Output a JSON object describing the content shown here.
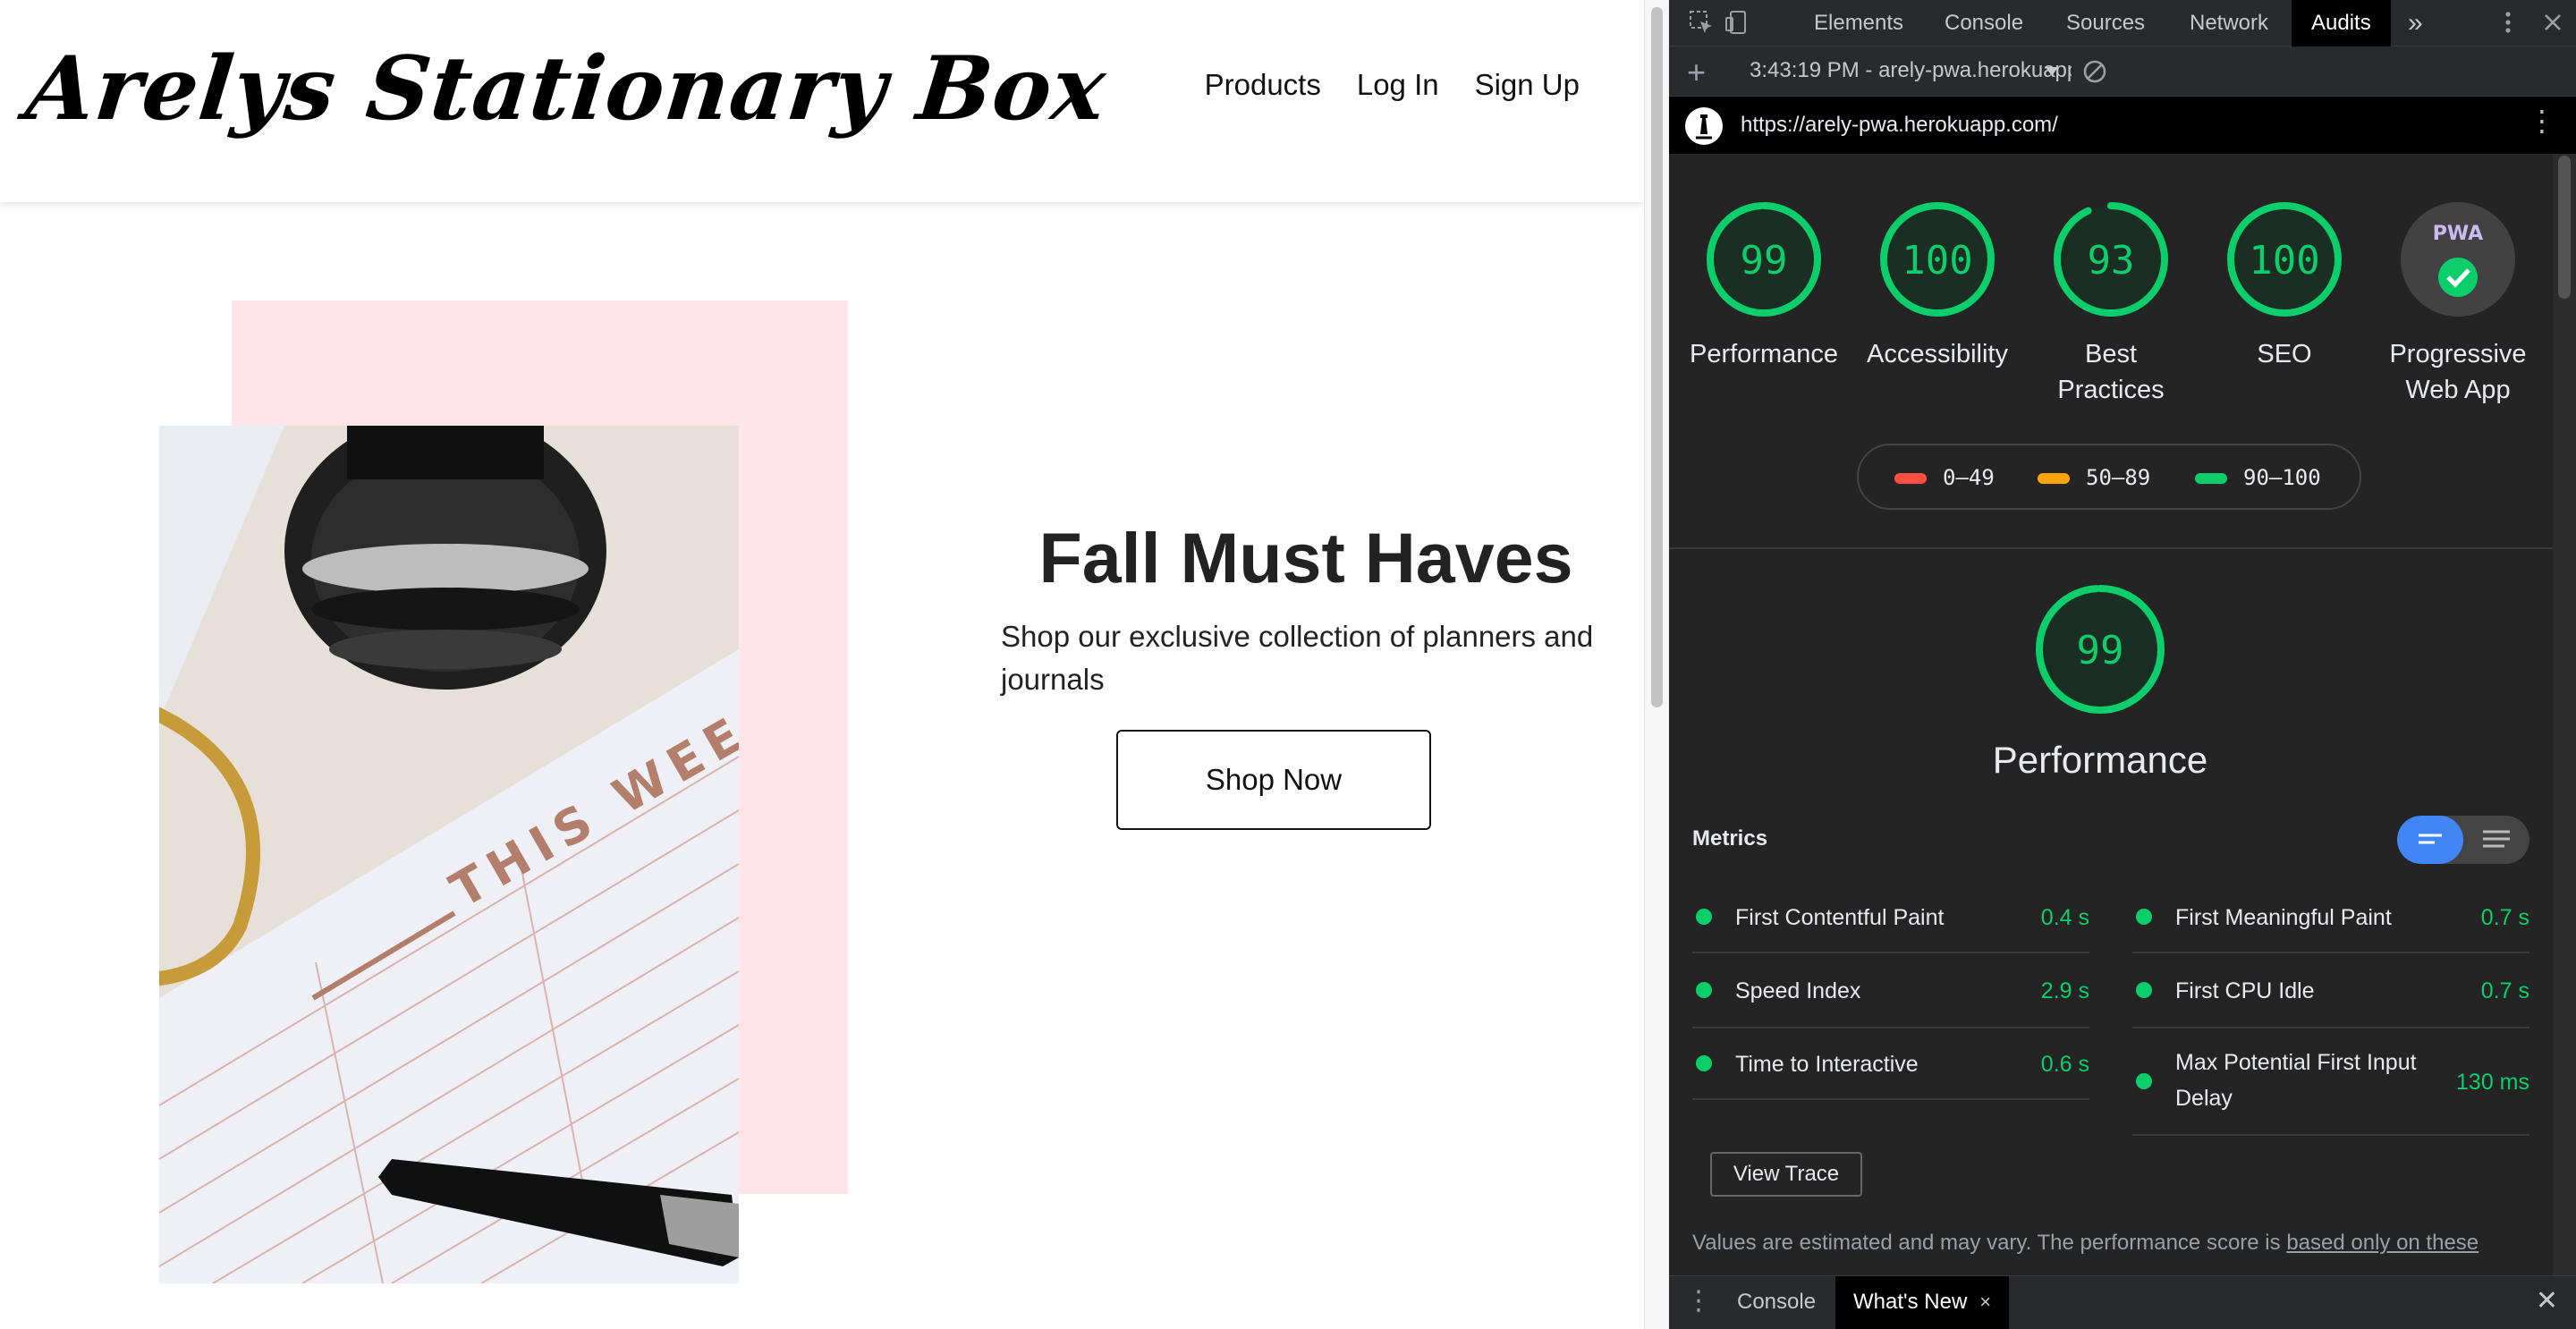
{
  "site": {
    "logo": "Arelys Stationary Box",
    "nav": [
      "Products",
      "Log In",
      "Sign Up"
    ],
    "hero": {
      "title": "Fall Must Haves",
      "subtitle": "Shop our exclusive collection of planners and journals",
      "cta": "Shop Now",
      "photo_text": "THIS WEE"
    }
  },
  "devtools": {
    "tabs": [
      "Elements",
      "Console",
      "Sources",
      "Network",
      "Audits"
    ],
    "active_tab": "Audits",
    "more_tabs": "»",
    "report_select": "3:43:19 PM - arely-pwa.herokuapp.com",
    "url": "https://arely-pwa.herokuapp.com/",
    "scores": [
      {
        "label": "Performance",
        "value": "99"
      },
      {
        "label": "Accessibility",
        "value": "100"
      },
      {
        "label": "Best Practices",
        "value": "93"
      },
      {
        "label": "SEO",
        "value": "100"
      }
    ],
    "pwa": {
      "label": "Progressive Web App",
      "badge_text": "PWA"
    },
    "legend": [
      {
        "range": "0–49",
        "color": "#ff4e42"
      },
      {
        "range": "50–89",
        "color": "#ffa400"
      },
      {
        "range": "90–100",
        "color": "#0cce6b"
      }
    ],
    "performance": {
      "score": "99",
      "title": "Performance",
      "metrics_heading": "Metrics",
      "metrics": [
        {
          "name": "First Contentful Paint",
          "value": "0.4 s"
        },
        {
          "name": "First Meaningful Paint",
          "value": "0.7 s"
        },
        {
          "name": "Speed Index",
          "value": "2.9 s"
        },
        {
          "name": "First CPU Idle",
          "value": "0.7 s"
        },
        {
          "name": "Time to Interactive",
          "value": "0.6 s"
        },
        {
          "name": "Max Potential First Input Delay",
          "value": "130 ms"
        }
      ],
      "view_trace": "View Trace",
      "note_text": "Values are estimated and may vary. The performance score is ",
      "note_link": "based only on these"
    },
    "drawer": {
      "tabs": [
        "Console",
        "What's New"
      ],
      "active": "What's New",
      "close_tab": "×"
    }
  },
  "colors": {
    "pass": "#0cce6b",
    "hero_bg": "#ffe4e9",
    "accent": "#4285f4"
  },
  "icons": [
    "inspect-icon",
    "device-toggle-icon",
    "kebab-menu-icon",
    "plus-icon",
    "dropdown-arrow-icon",
    "block-icon",
    "lighthouse-icon",
    "checkmark-icon",
    "close-icon"
  ]
}
